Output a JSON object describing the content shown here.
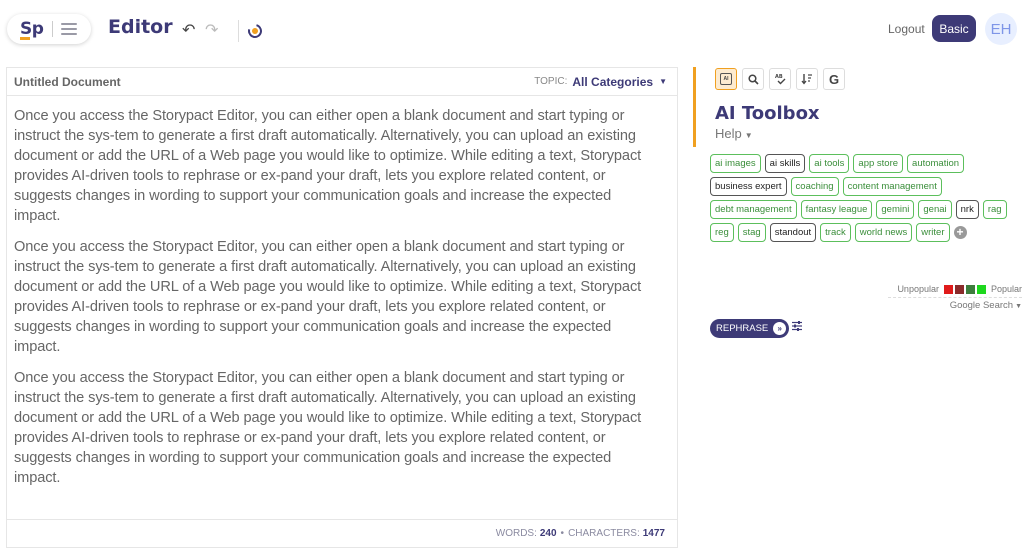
{
  "header": {
    "brand": "Sp",
    "app_title": "Editor",
    "icons": {
      "undo": "undo-icon",
      "redo": "redo-icon",
      "history": "history-icon",
      "menu": "hamburger-icon"
    },
    "logout_label": "Logout",
    "plan_label": "Basic",
    "avatar_initials": "EH",
    "colors": {
      "brand": "#3d3a77",
      "accent": "#f0a020"
    }
  },
  "editor": {
    "doc_title": "Untitled Document",
    "topic_label": "TOPIC:",
    "topic_value": "All Categories",
    "paragraphs": [
      "Once you access the Storypact Editor, you can either open a blank document and start typing or instruct the sys-tem to generate a first draft automatically. Alternatively, you can upload an existing document or add the URL of a Web page you would like to optimize. While editing a text, Storypact provides AI-driven tools to rephrase or ex-pand your draft, lets you explore related content, or suggests changes in wording to support your communication goals and increase the expected impact.",
      "Once you access the Storypact Editor, you can either open a blank document and start typing or instruct the sys-tem to generate a first draft automatically. Alternatively, you can upload an existing document or add the URL of a Web page you would like to optimize. While editing a text, Storypact provides AI-driven tools to rephrase or ex-pand your draft, lets you explore related content, or suggests changes in wording to support your communication goals and increase the expected impact.",
      "Once you access the Storypact Editor, you can either open a blank document and start typing or instruct the sys-tem to generate a first draft automatically. Alternatively, you can upload an existing document or add the URL of a Web page you would like to optimize. While editing a text, Storypact provides AI-driven tools to rephrase or ex-pand your draft, lets you explore related content, or suggests changes in wording to support your communication goals and increase the expected impact."
    ],
    "footer": {
      "words_label": "WORDS:",
      "words_value": "240",
      "separator": "•",
      "chars_label": "CHARACTERS:",
      "chars_value": "1477"
    }
  },
  "toolbox": {
    "tools": [
      {
        "name": "ai-chip-icon",
        "glyph": "AI",
        "active": true
      },
      {
        "name": "search-icon",
        "glyph": "🔍︎",
        "active": false
      },
      {
        "name": "spellcheck-icon",
        "glyph": "ᴬᴮ✓",
        "active": false
      },
      {
        "name": "sort-icon",
        "glyph": "↓≡",
        "active": false
      },
      {
        "name": "google-icon",
        "glyph": "G",
        "active": false
      }
    ],
    "title": "AI Toolbox",
    "help_label": "Help",
    "tags": [
      {
        "label": "ai images",
        "style": "green"
      },
      {
        "label": "ai skills",
        "style": "dark"
      },
      {
        "label": "ai tools",
        "style": "green"
      },
      {
        "label": "app store",
        "style": "green"
      },
      {
        "label": "automation",
        "style": "green"
      },
      {
        "label": "business expert",
        "style": "dark"
      },
      {
        "label": "coaching",
        "style": "green"
      },
      {
        "label": "content management",
        "style": "green"
      },
      {
        "label": "debt management",
        "style": "green"
      },
      {
        "label": "fantasy league",
        "style": "green"
      },
      {
        "label": "gemini",
        "style": "green"
      },
      {
        "label": "genai",
        "style": "green"
      },
      {
        "label": "nrk",
        "style": "dark"
      },
      {
        "label": "rag",
        "style": "green"
      },
      {
        "label": "reg",
        "style": "green"
      },
      {
        "label": "stag",
        "style": "green"
      },
      {
        "label": "standout",
        "style": "dark"
      },
      {
        "label": "track",
        "style": "green"
      },
      {
        "label": "world news",
        "style": "green"
      },
      {
        "label": "writer",
        "style": "green"
      }
    ],
    "add_tag_label": "+",
    "legend": {
      "left_label": "Unpopular",
      "right_label": "Popular",
      "swatches": [
        "#e01b1b",
        "#8b2b2b",
        "#3d7d3d",
        "#1ed81e"
      ]
    },
    "search_source": "Google Search",
    "rephrase_label": "REPHRASE",
    "rephrase_go": "»"
  }
}
